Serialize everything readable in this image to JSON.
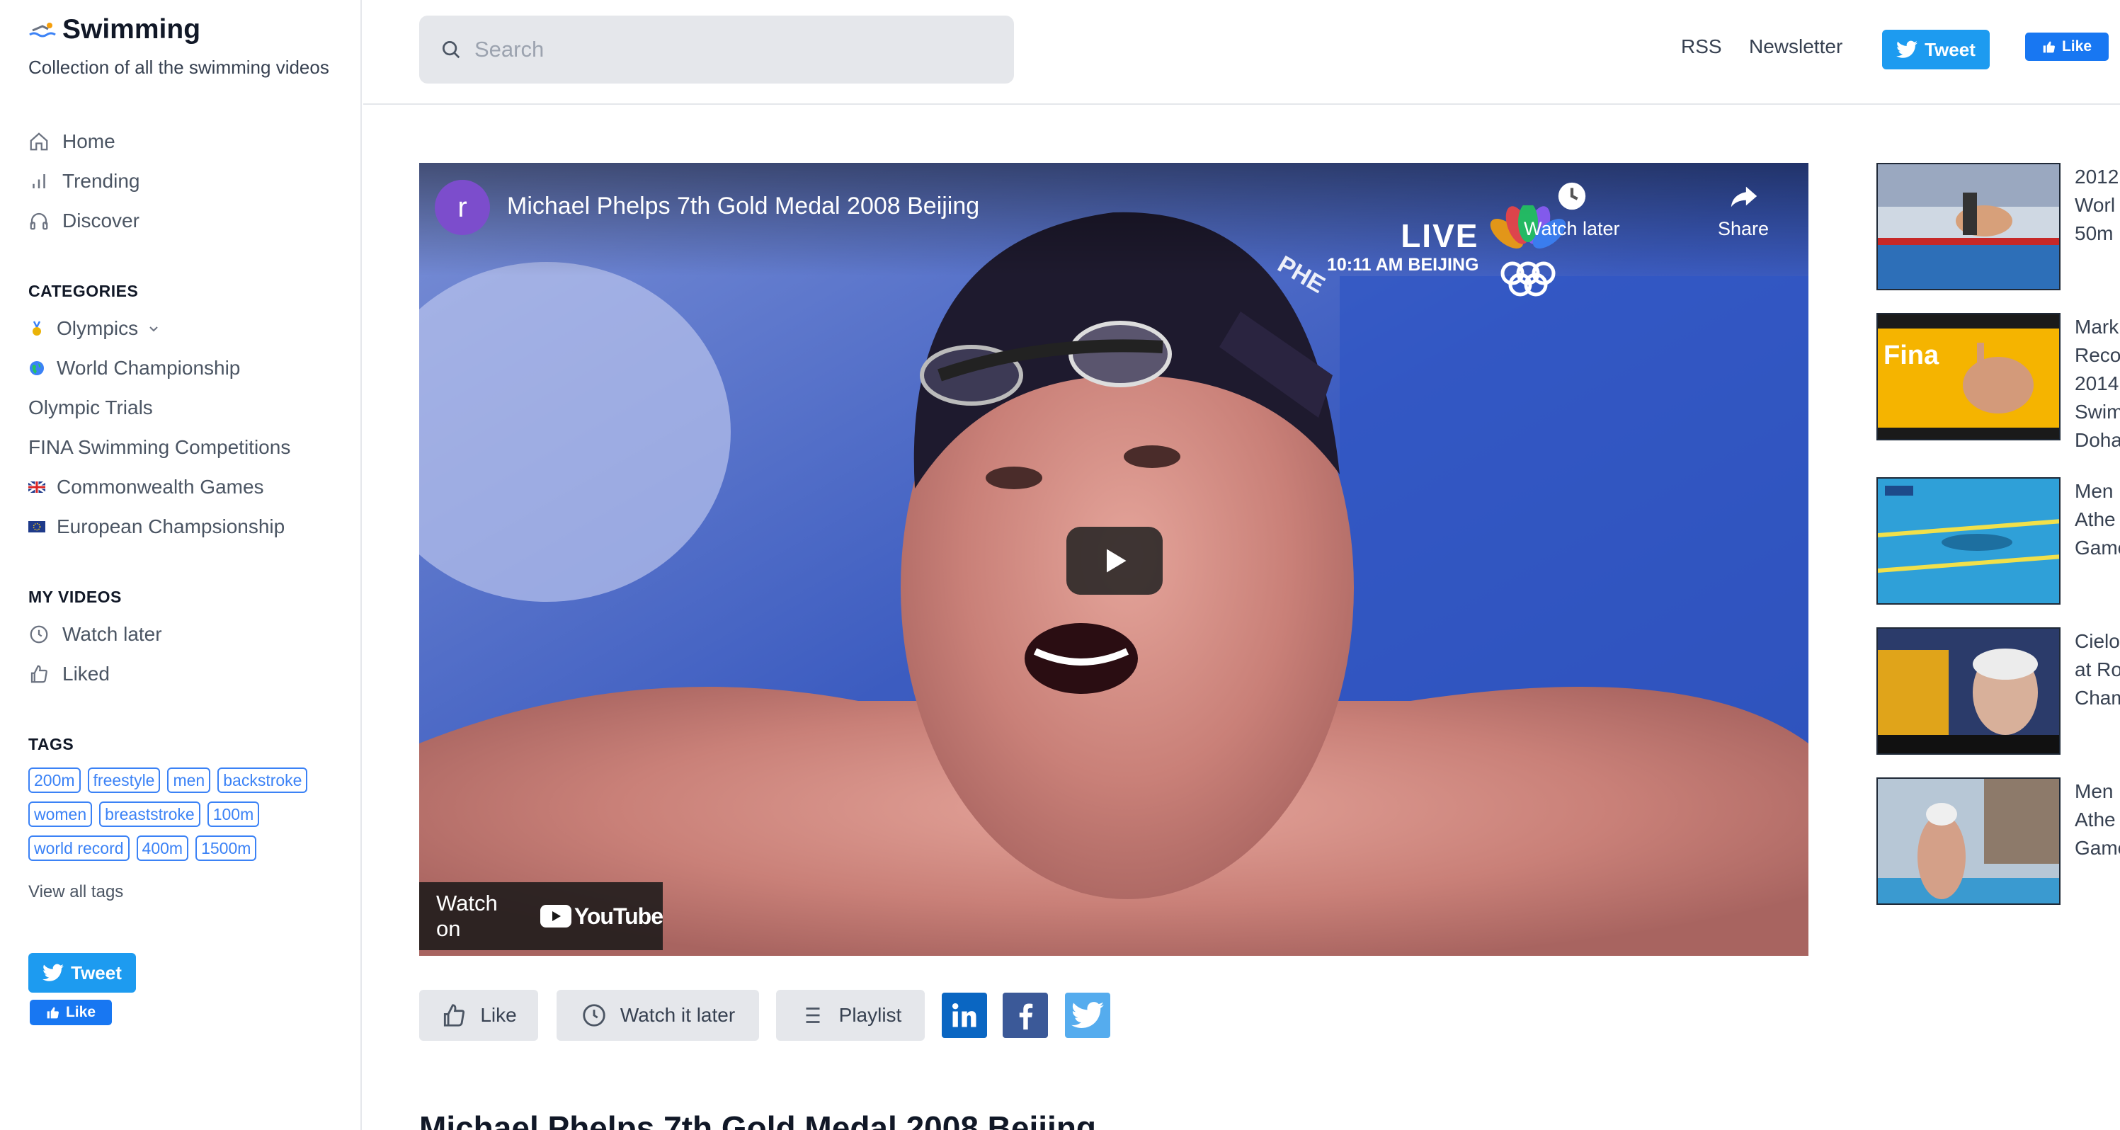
{
  "brand": {
    "title": "Swimming",
    "subtitle": "Collection of all the swimming videos"
  },
  "nav": [
    {
      "label": "Home",
      "icon": "home-icon"
    },
    {
      "label": "Trending",
      "icon": "bar-chart-icon"
    },
    {
      "label": "Discover",
      "icon": "headphones-icon"
    }
  ],
  "categories": {
    "heading": "CATEGORIES",
    "items": [
      {
        "label": "Olympics",
        "icon": "medal-icon"
      },
      {
        "label": "World Championship",
        "icon": "globe-icon"
      },
      {
        "label": "Olympic Trials"
      },
      {
        "label": "FINA Swimming Competitions"
      },
      {
        "label": "Commonwealth Games",
        "icon": "uk-flag-icon"
      },
      {
        "label": "European Champsionship",
        "icon": "eu-flag-icon"
      }
    ]
  },
  "my_videos": {
    "heading": "MY VIDEOS",
    "items": [
      {
        "label": "Watch later",
        "icon": "clock-icon"
      },
      {
        "label": "Liked",
        "icon": "thumbs-up-icon"
      }
    ]
  },
  "tags": {
    "heading": "TAGS",
    "rows": [
      [
        "200m",
        "freestyle",
        "men",
        "backstroke"
      ],
      [
        "women",
        "breaststroke",
        "100m"
      ],
      [
        "world record",
        "400m",
        "1500m"
      ]
    ],
    "view_all": "View all tags"
  },
  "share": {
    "tweet": "Tweet",
    "like": "Like"
  },
  "search": {
    "placeholder": "Search"
  },
  "top_links": {
    "rss": "RSS",
    "newsletter": "Newsletter",
    "tweet": "Tweet",
    "like": "Like"
  },
  "video": {
    "channel_initial": "r",
    "title": "Michael Phelps 7th Gold Medal 2008 Beijing",
    "watch_later": "Watch later",
    "share": "Share",
    "live": "LIVE",
    "live_time": "10:11 AM BEIJING",
    "watch_on": "Watch on",
    "youtube": "YouTube"
  },
  "actions": {
    "like": "Like",
    "watch_later": "Watch it later",
    "playlist": "Playlist"
  },
  "page_title": "Michael Phelps 7th Gold Medal 2008 Beijing",
  "related": [
    {
      "text": "2012\nWorl\n50m"
    },
    {
      "text": "Mark\nReco\n2014\nSwim\nDoha"
    },
    {
      "text": "Men\nAthe\nGame"
    },
    {
      "text": "Cielo\nat Ro\nCham"
    },
    {
      "text": "Men\nAthe\nGame"
    }
  ],
  "colors": {
    "accent": "#3b82f6",
    "twitter": "#1d9bf0",
    "facebook": "#1877f2",
    "linkedin": "#0a66c2",
    "fb_square": "#3b5998",
    "twitter_square": "#55acee"
  }
}
